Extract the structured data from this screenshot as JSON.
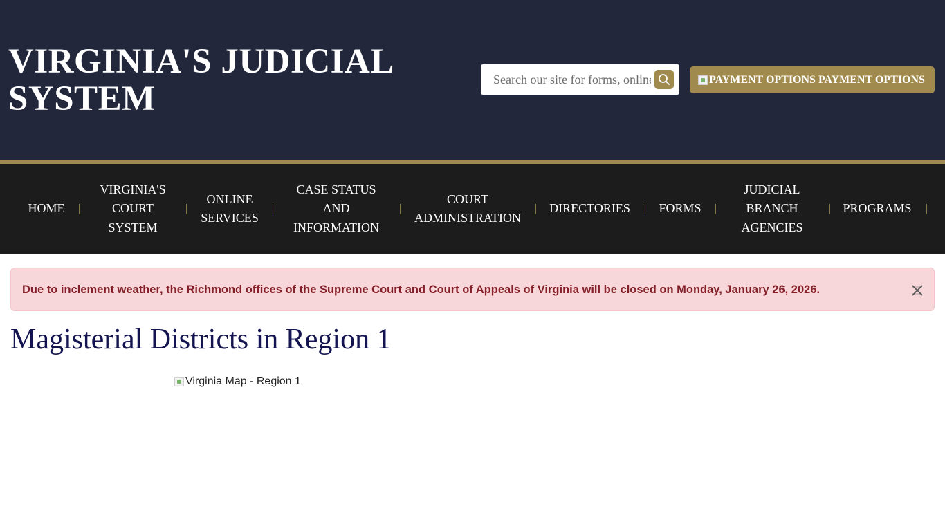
{
  "header": {
    "site_title": "VIRGINIA'S JUDICIAL SYSTEM",
    "search_placeholder": "Search our site for forms, online services, and more",
    "payment_img_alt": "PAYMENT OPTIONS",
    "payment_label": "PAYMENT OPTIONS"
  },
  "nav": {
    "items": [
      {
        "label": "HOME"
      },
      {
        "label": "VIRGINIA'S COURT SYSTEM"
      },
      {
        "label": "ONLINE SERVICES"
      },
      {
        "label": "CASE STATUS AND INFORMATION"
      },
      {
        "label": "COURT ADMINISTRATION"
      },
      {
        "label": "DIRECTORIES"
      },
      {
        "label": "FORMS"
      },
      {
        "label": "JUDICIAL BRANCH AGENCIES"
      },
      {
        "label": "PROGRAMS"
      }
    ],
    "separator": "|"
  },
  "alert": {
    "message": "Due to inclement weather, the Richmond offices of the Supreme Court and Court of Appeals of Virginia will be closed on Monday, January 26, 2026."
  },
  "main": {
    "title": "Magisterial Districts in Region 1",
    "map_alt": "Virginia Map - Region 1"
  },
  "colors": {
    "header_bg": "#22273b",
    "gold": "#a08a4e",
    "nav_bg": "#1c1c1c",
    "alert_bg": "#f8d7da",
    "alert_text": "#842029",
    "title": "#141450"
  }
}
